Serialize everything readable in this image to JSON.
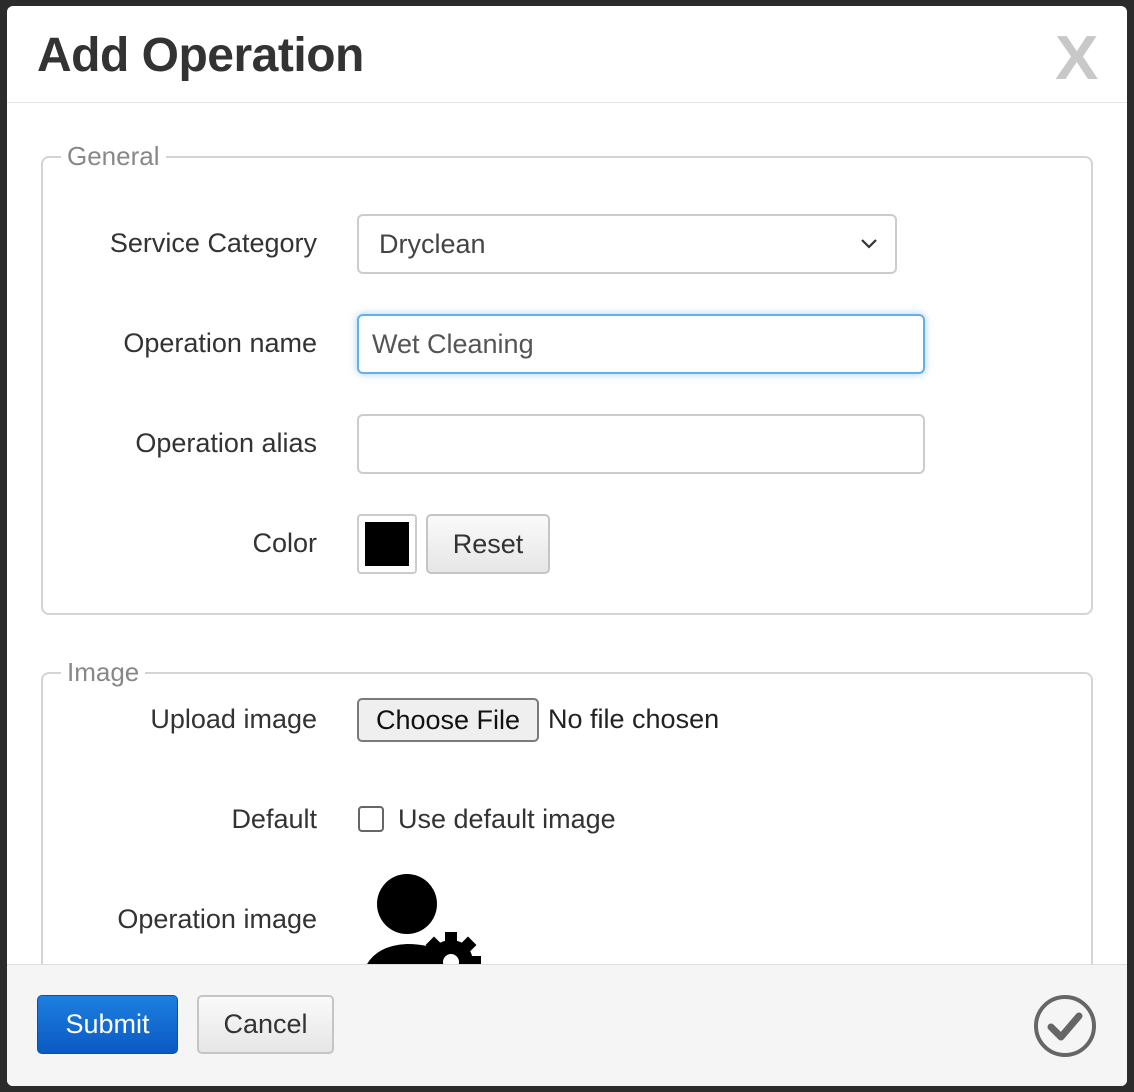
{
  "modal": {
    "title": "Add Operation",
    "close_label": "X"
  },
  "general": {
    "legend": "General",
    "service_category": {
      "label": "Service Category",
      "selected": "Dryclean"
    },
    "operation_name": {
      "label": "Operation name",
      "value": "Wet Cleaning"
    },
    "operation_alias": {
      "label": "Operation alias",
      "value": ""
    },
    "color": {
      "label": "Color",
      "value": "#000000",
      "reset_label": "Reset"
    }
  },
  "image": {
    "legend": "Image",
    "upload": {
      "label": "Upload image",
      "button_label": "Choose File",
      "status": "No file chosen"
    },
    "default": {
      "label": "Default",
      "checkbox_label": "Use default image",
      "checked": false
    },
    "operation_image": {
      "label": "Operation image",
      "icon": "person-gear-icon"
    }
  },
  "footer": {
    "submit_label": "Submit",
    "cancel_label": "Cancel",
    "confirm_icon": "check-circle-icon"
  },
  "colors": {
    "primary": "#0a5ac4",
    "focus": "#66afe9"
  }
}
